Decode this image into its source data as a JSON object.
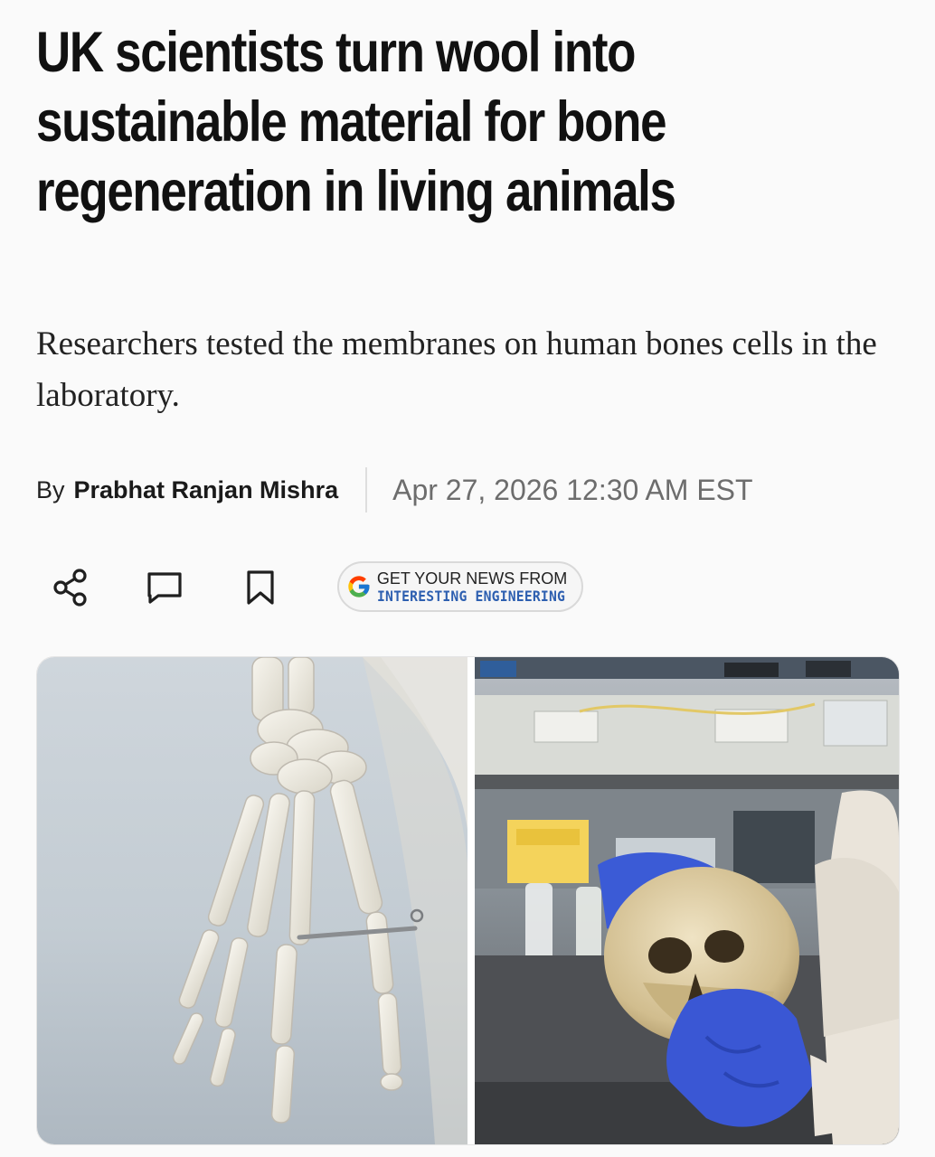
{
  "article": {
    "headline": "UK scientists turn wool into sustainable material for bone regeneration in living animals",
    "dek": "Researchers tested the membranes on human bones cells in the laboratory.",
    "byline_prefix": "By",
    "author": "Prabhat Ranjan Mishra",
    "date": "Apr 27, 2026 12:30 AM EST"
  },
  "actions": {
    "icons": [
      "share-icon",
      "comment-icon",
      "bookmark-icon"
    ],
    "google_news": {
      "line1": "GET YOUR NEWS FROM",
      "line2": "INTERESTING ENGINEERING",
      "brand_color": "#2d5fb0"
    }
  },
  "hero_image": {
    "left_panel": "skeleton hand with metal pin",
    "right_panel": "gloved hand holding a human skull in a laboratory"
  }
}
